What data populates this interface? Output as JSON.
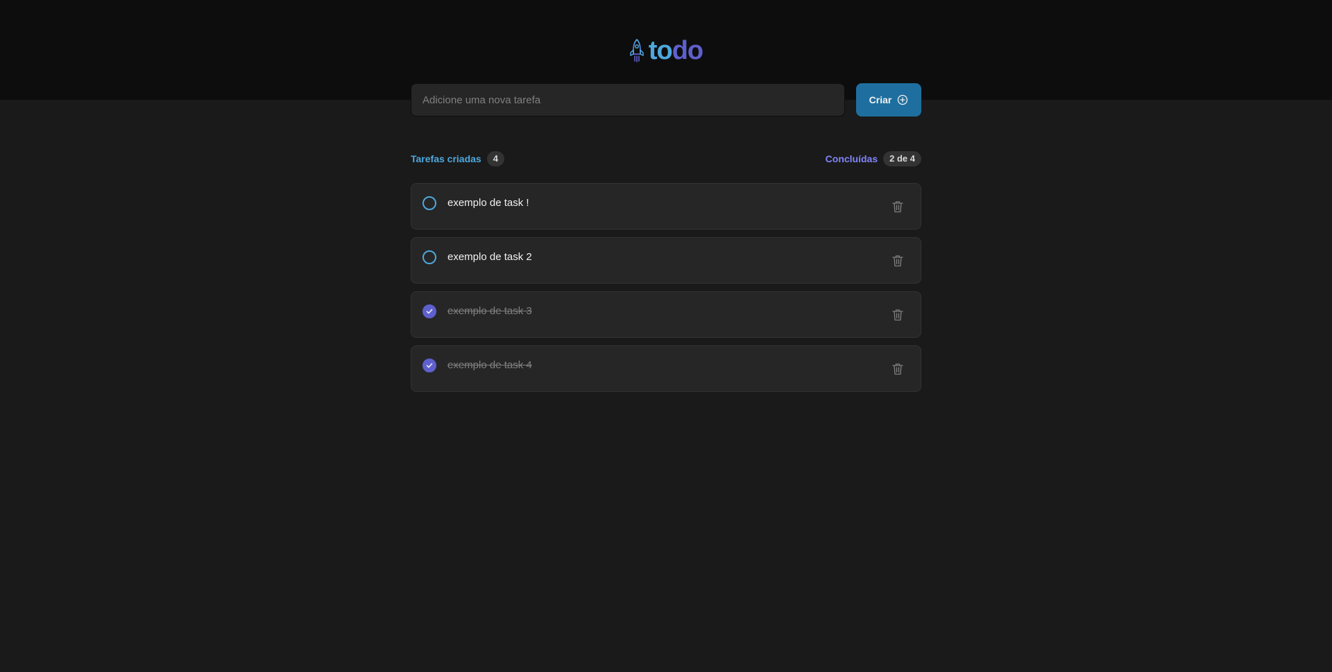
{
  "logo": {
    "text_part1": "to",
    "text_part2": "do",
    "icon": "rocket-icon",
    "color_part1": "#4ea8de",
    "color_part2": "#5e60ce"
  },
  "new_task": {
    "placeholder": "Adicione uma nova tarefa",
    "value": "",
    "create_label": "Criar",
    "create_icon": "plus-circle-icon"
  },
  "info": {
    "created_label": "Tarefas criadas",
    "created_count": "4",
    "done_label": "Concluídas",
    "done_count": "2 de 4"
  },
  "tasks": [
    {
      "text": "exemplo de task !",
      "done": false
    },
    {
      "text": "exemplo de task 2",
      "done": false
    },
    {
      "text": "exemplo de task 3",
      "done": true
    },
    {
      "text": "exemplo de task 4",
      "done": true
    }
  ],
  "colors": {
    "blue": "#4ea8de",
    "blue_dark": "#1e6f9f",
    "purple": "#5e60ce",
    "purple_light": "#8284fa"
  },
  "icons": {
    "check": "check-circle-icon",
    "empty": "circle-icon",
    "delete": "trash-icon"
  }
}
